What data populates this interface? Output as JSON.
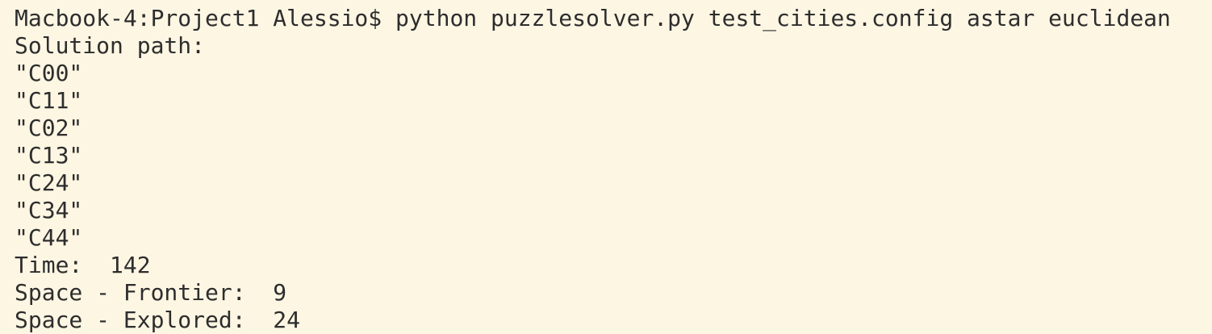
{
  "terminal": {
    "prompt": "Macbook-4:Project1 Alessio$",
    "command": "python puzzlesolver.py test_cities.config astar euclidean",
    "output": {
      "solution_header": "Solution path:",
      "path": [
        "\"C00\"",
        "\"C11\"",
        "\"C02\"",
        "\"C13\"",
        "\"C24\"",
        "\"C34\"",
        "\"C44\""
      ],
      "time_label": "Time:",
      "time_value": "142",
      "frontier_label": "Space - Frontier:",
      "frontier_value": "9",
      "explored_label": "Space - Explored:",
      "explored_value": "24"
    }
  },
  "colors": {
    "background": "#fdf6e3",
    "text": "#2d2d2d"
  }
}
